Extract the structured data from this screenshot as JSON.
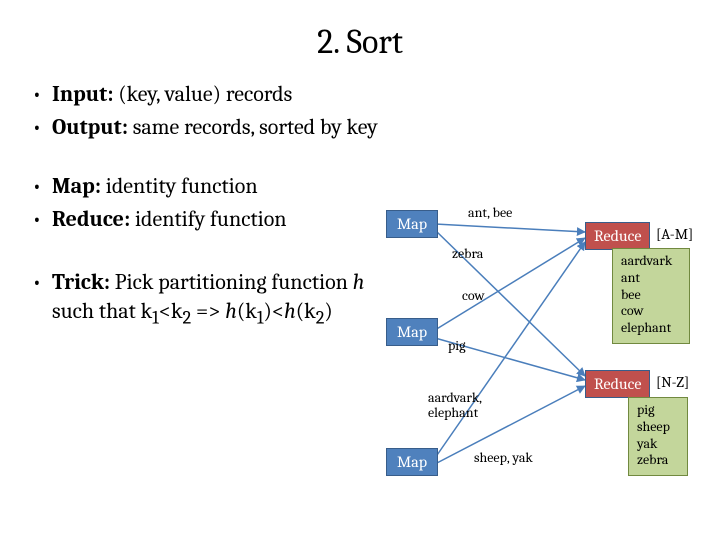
{
  "title": "2. Sort",
  "bullets": {
    "group1": [
      {
        "label": "Input:",
        "rest": " (key, value) records"
      },
      {
        "label": "Output:",
        "rest": " same records, sorted by key"
      }
    ],
    "group2": [
      {
        "label": "Map:",
        "rest": " identity function"
      },
      {
        "label": "Reduce:",
        "rest": " identify function"
      }
    ],
    "group3": [
      {
        "label": "Trick:",
        "rest": " Pick partitioning function ",
        "tail_html": "h such that k₁<k₂ => h(k₁)<h(k₂)"
      }
    ]
  },
  "diagram": {
    "map_label": "Map",
    "reduce_label": "Reduce",
    "range_am": "[A-M]",
    "range_nz": "[N-Z]",
    "edges": {
      "ant_bee": "ant, bee",
      "zebra": "zebra",
      "cow": "cow",
      "pig": "pig",
      "aardvark_elephant": "aardvark,\nelephant",
      "sheep_yak": "sheep, yak"
    },
    "results": {
      "am": [
        "aardvark",
        "ant",
        "bee",
        "cow",
        "elephant"
      ],
      "nz": [
        "pig",
        "sheep",
        "yak",
        "zebra"
      ]
    }
  }
}
